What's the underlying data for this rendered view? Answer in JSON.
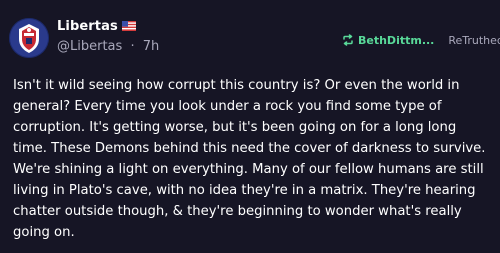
{
  "post": {
    "author": {
      "display_name": "Libertas",
      "flag": "us-flag-icon",
      "handle": "@Libertas",
      "separator": "·",
      "timestamp": "7h"
    },
    "retruth": {
      "icon": "retruth-icon",
      "user": "BethDittm...",
      "label": "ReTruthed"
    },
    "body": "Isn't it wild seeing how corrupt this country is? Or even the world in general? Every time you look under a rock you find some type of corruption. It's getting worse, but it's been going on for a long long time. These Demons behind this need the cover of darkness to survive. We're shining a light on everything. Many of our fellow humans are still living in Plato's cave, with no idea they're in a matrix. They're hearing chatter outside though, & they're beginning to wonder what's really going on."
  },
  "colors": {
    "background": "#161525",
    "text": "#ffffff",
    "muted": "#a9a8bb",
    "retruth_accent": "#59d999"
  }
}
